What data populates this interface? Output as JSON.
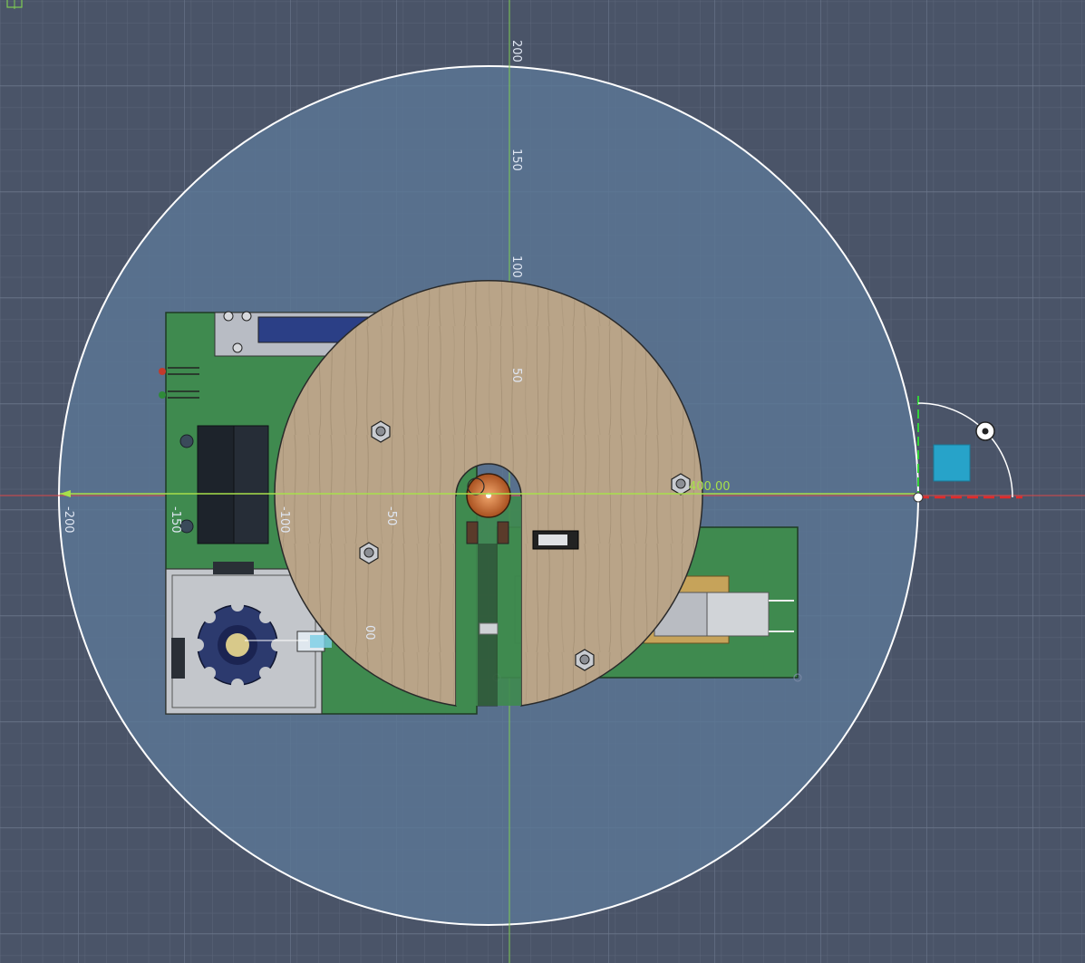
{
  "colors": {
    "background": "#4a5468",
    "grid_minor": "#5b6579",
    "grid_major": "#6c778c",
    "axis_x": "#d94848",
    "axis_y": "#7ecb53",
    "sketch_circle_fill": "#5a7594",
    "sketch_circle_stroke": "#ffffff",
    "wood_disk": "#b9a488",
    "pcb_green": "#3f8a4f",
    "dimension": "#a7e04a",
    "view_cube": "#27a3c9"
  },
  "axes": {
    "x_tick_labels": [
      "-200",
      "-150",
      "-100",
      "-50"
    ],
    "y_tick_labels": [
      "200",
      "150",
      "100",
      "50"
    ]
  },
  "dimension": {
    "value": "400.00"
  },
  "partial_label": {
    "text": "00"
  },
  "icons": {
    "origin": "origin-icon",
    "rotate_handle": "rotate-handle-icon",
    "view_cube": "view-cube-icon"
  }
}
